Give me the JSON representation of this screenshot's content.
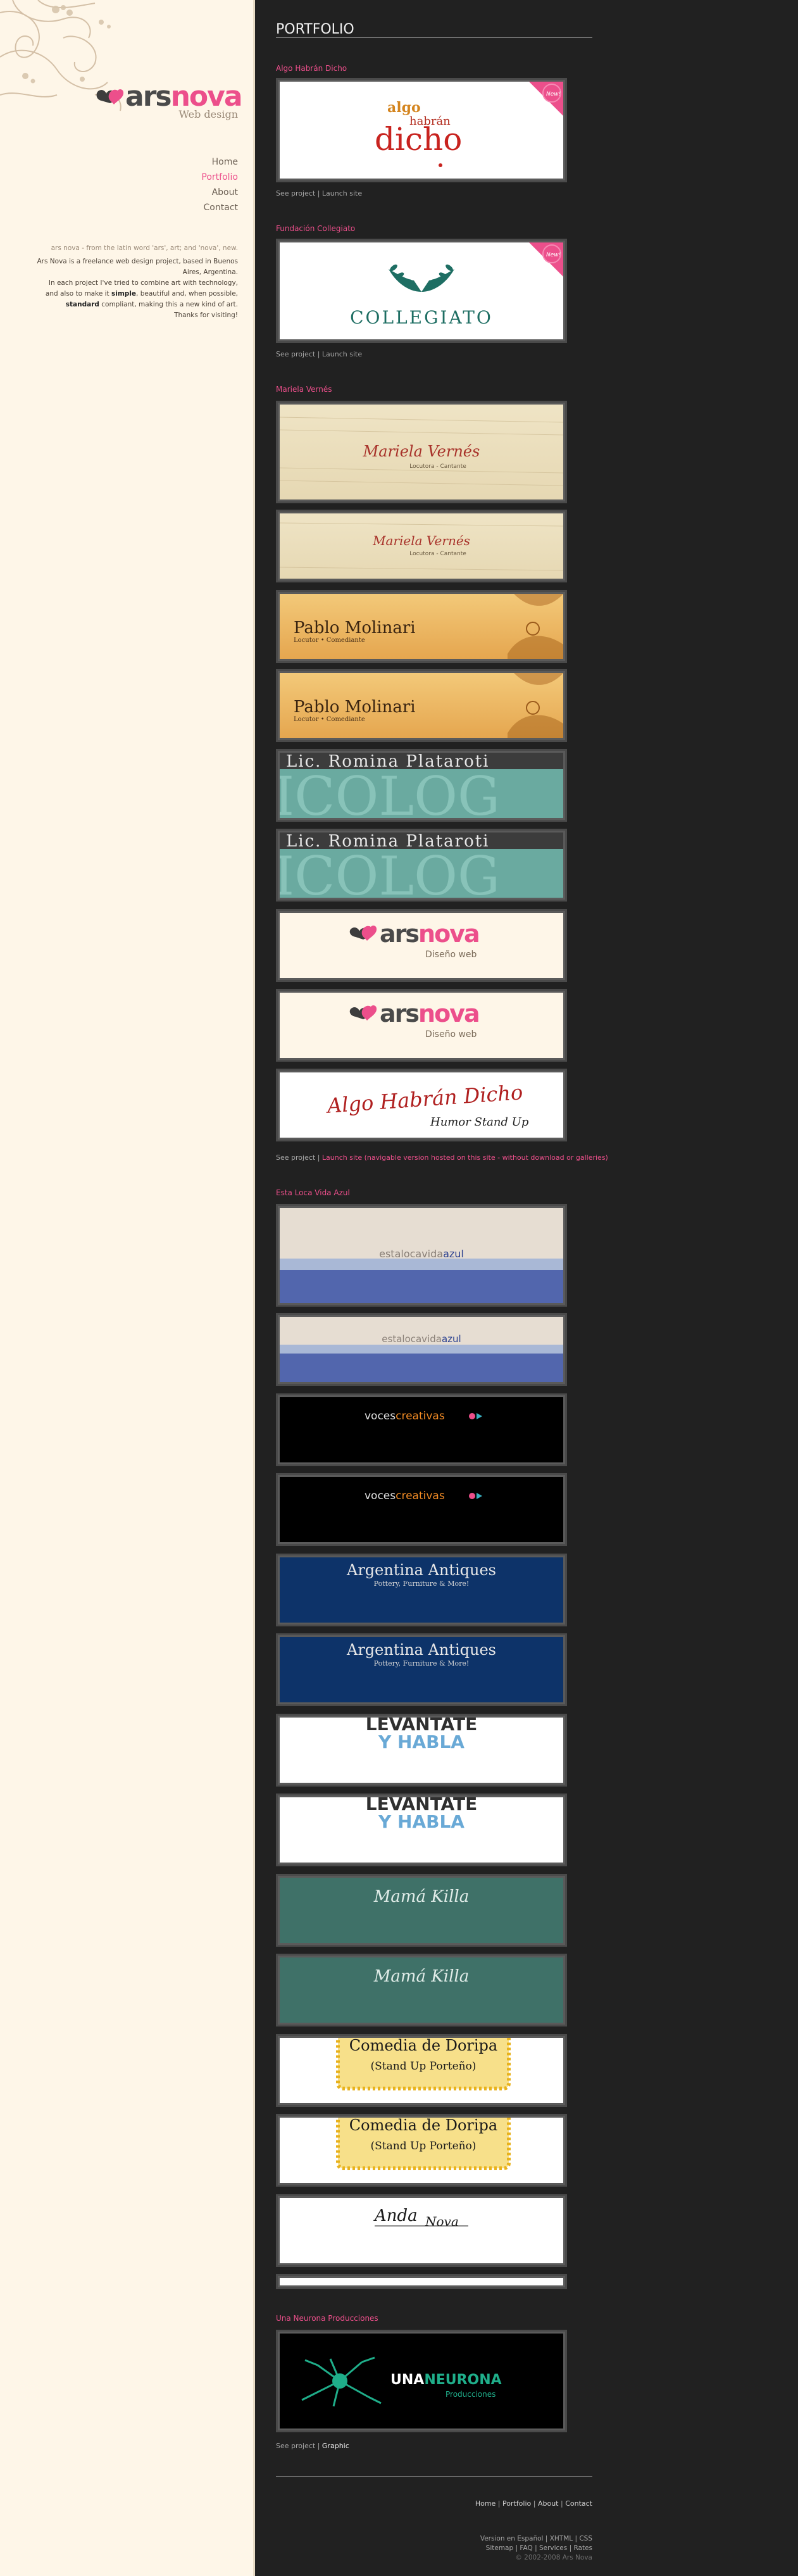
{
  "site": {
    "logo_word_dark": "ars",
    "logo_word_pink": "nova",
    "logo_sub": "Web design"
  },
  "nav": [
    {
      "label": "Home",
      "active": false
    },
    {
      "label": "Portfolio",
      "active": true
    },
    {
      "label": "About",
      "active": false
    },
    {
      "label": "Contact",
      "active": false
    }
  ],
  "about": {
    "etymology": "ars nova - from the latin word 'ars', art; and 'nova', new.",
    "intro": "Ars Nova is a freelance web design project, based in Buenos Aires, Argentina.",
    "line1": "In each project I've tried to combine art with technology,",
    "line2_pre": "and also to make it ",
    "line2_bold": "simple",
    "line2_post": ", beautiful and, when possible,",
    "line3_bold": "standard",
    "line3_post": " compliant, making this a new kind of art.",
    "thanks": "Thanks for visiting!"
  },
  "page": {
    "title": "PORTFOLIO"
  },
  "sections": {
    "s1": {
      "title": "Algo Habrán Dicho",
      "see": "See project",
      "sep": "|",
      "launch": "Launch site"
    },
    "s2": {
      "title": "Fundación Collegiato",
      "see": "See project",
      "sep": "|",
      "launch": "Launch site"
    },
    "s3": {
      "title": "Mariela Vernés",
      "see": "See project",
      "sep": "|",
      "launch": "Launch site (navigable version hosted on this site - without download or galleries)"
    },
    "s4": {
      "title": "Esta Loca Vida Azul"
    },
    "s5": {
      "title": "Una Neurona Producciones",
      "see": "See project",
      "sep": "|",
      "graphic": "Graphic"
    }
  },
  "shots": {
    "algo": {
      "w1": "algo",
      "w2": "habrán",
      "w3": "dicho",
      "w4": "",
      "badge": "New!"
    },
    "collegiato": {
      "name": "COLLEGIATO",
      "badge": "New!"
    },
    "mariela": {
      "name": "Mariela Vernés",
      "role": "Locutora - Cantante"
    },
    "pablo": {
      "name": "Pablo Molinari",
      "role": "Locutor • Comediante"
    },
    "romina": {
      "name": "Lic. Romina Plataroti",
      "bg_word": "ICOLOG"
    },
    "arsnova": {
      "dark": "ars",
      "pink": "nova",
      "sub": "Diseño web"
    },
    "ahd": {
      "top": "Algo Habrán Dicho",
      "sub": "Humor Stand Up"
    },
    "estaloca": {
      "pre": "estalocavida",
      "accent": "azul"
    },
    "voces": {
      "pre": "voces",
      "accent": "creativas"
    },
    "antiques": {
      "name": "Argentina Antiques",
      "sub": "Pottery, Furniture & More!"
    },
    "levantate": {
      "l1": "LEVANTATE",
      "l2": "Y  HABLA"
    },
    "mama": {
      "name": "Mamá Killa"
    },
    "doripa": {
      "l1": "Comedia de Doripa",
      "l2": "(Stand Up Porteño)"
    },
    "anda": {
      "a": "Anda",
      "b": "Nova"
    },
    "neurona": {
      "pre": "UNA",
      "accent": "NEURONA",
      "sub": "Producciones"
    }
  },
  "footer": {
    "nav": [
      {
        "label": "Home"
      },
      {
        "label": "Portfolio"
      },
      {
        "label": "About"
      },
      {
        "label": "Contact"
      }
    ],
    "meta1": [
      "Version en Español",
      "XHTML",
      "CSS"
    ],
    "meta2": [
      "Sitemap",
      "FAQ",
      "Services",
      "Rates"
    ],
    "copyright": "© 2002-2008 Ars Nova"
  },
  "colors": {
    "accent": "#ec4f8b",
    "sidebar": "#fef6e8",
    "main_bg": "#212121"
  }
}
